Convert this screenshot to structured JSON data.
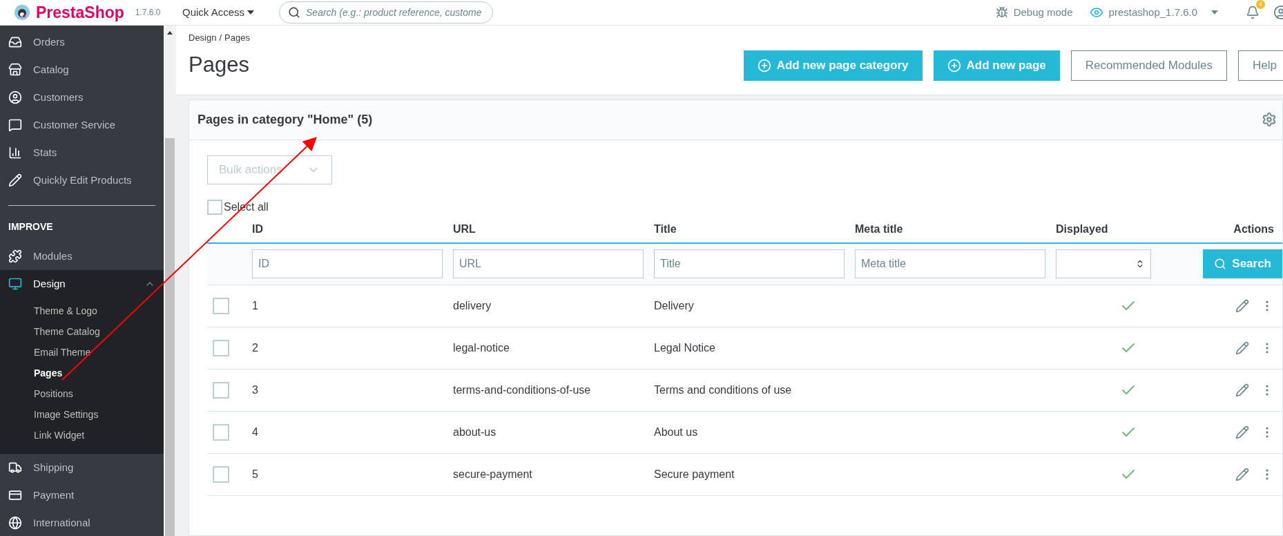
{
  "topbar": {
    "logo": "PrestaShop",
    "version": "1.7.6.0",
    "quick_access": "Quick Access",
    "search_placeholder": "Search (e.g.: product reference, custome",
    "debug": "Debug mode",
    "shop": "prestashop_1.7.6.0",
    "notification_count": "4"
  },
  "sidebar": {
    "items": [
      {
        "label": "Orders",
        "selected": false
      },
      {
        "label": "Catalog",
        "selected": false
      },
      {
        "label": "Customers",
        "selected": false
      },
      {
        "label": "Customer Service",
        "selected": false
      },
      {
        "label": "Stats",
        "selected": false
      },
      {
        "label": "Quickly Edit Products",
        "selected": false
      }
    ],
    "section": "IMPROVE",
    "improve_items": [
      {
        "label": "Modules",
        "selected": false,
        "expanded": false
      },
      {
        "label": "Design",
        "selected": true,
        "expanded": true,
        "children": [
          {
            "label": "Theme & Logo",
            "selected": false
          },
          {
            "label": "Theme Catalog",
            "selected": false
          },
          {
            "label": "Email Theme",
            "selected": false
          },
          {
            "label": "Pages",
            "selected": true
          },
          {
            "label": "Positions",
            "selected": false
          },
          {
            "label": "Image Settings",
            "selected": false
          },
          {
            "label": "Link Widget",
            "selected": false
          }
        ]
      },
      {
        "label": "Shipping",
        "selected": false,
        "expanded": false
      },
      {
        "label": "Payment",
        "selected": false,
        "expanded": false
      },
      {
        "label": "International",
        "selected": false,
        "expanded": false
      }
    ]
  },
  "breadcrumb": [
    "Design",
    "Pages"
  ],
  "breadcrumb_separator": "/",
  "page_title": "Pages",
  "toolbar_buttons": [
    {
      "label": "Add new page category",
      "kind": "primary"
    },
    {
      "label": "Add new page",
      "kind": "primary"
    },
    {
      "label": "Recommended Modules",
      "kind": "outline"
    },
    {
      "label": "Help",
      "kind": "outline"
    }
  ],
  "card": {
    "title": "Pages in category \"Home\" (5)",
    "bulk_actions": "Bulk actions",
    "select_all": "Select all",
    "select_all_checked": false,
    "columns": [
      "ID",
      "URL",
      "Title",
      "Meta title",
      "Displayed",
      "Actions"
    ],
    "filters": [
      {
        "placeholder": "ID"
      },
      {
        "placeholder": "URL"
      },
      {
        "placeholder": "Title"
      },
      {
        "placeholder": "Meta title"
      }
    ],
    "search_button": "Search",
    "rows": [
      {
        "id": "1",
        "url": "delivery",
        "title": "Delivery",
        "displayed": true,
        "checked": false
      },
      {
        "id": "2",
        "url": "legal-notice",
        "title": "Legal Notice",
        "displayed": true,
        "checked": false
      },
      {
        "id": "3",
        "url": "terms-and-conditions-of-use",
        "title": "Terms and conditions of use",
        "displayed": true,
        "checked": false
      },
      {
        "id": "4",
        "url": "about-us",
        "title": "About us",
        "displayed": true,
        "checked": false
      },
      {
        "id": "5",
        "url": "secure-payment",
        "title": "Secure payment",
        "displayed": true,
        "checked": false
      }
    ]
  }
}
